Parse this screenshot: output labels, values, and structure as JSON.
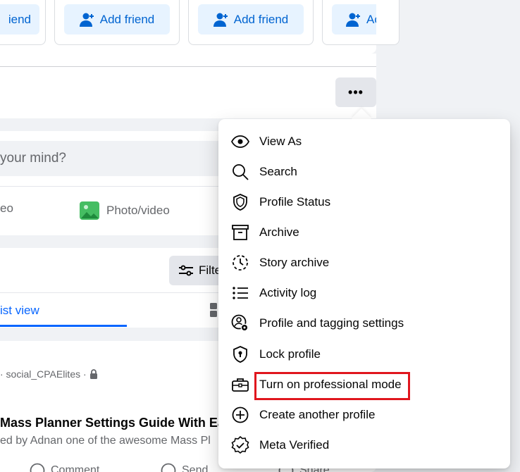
{
  "friends": {
    "add_label": "Add friend",
    "partial_first": "iend",
    "partial_last": "Ac"
  },
  "profile": {
    "more_label": "•••"
  },
  "composer": {
    "placeholder": "your mind?",
    "live_partial": "eo",
    "photo_label": "Photo/video"
  },
  "posts": {
    "filter_label": "Filte",
    "list_view_label": "ist view"
  },
  "post": {
    "meta": "· social_CPAElites ·",
    "title": "Mass Planner Settings Guide With Ea",
    "subtitle": "ed by Adnan one of the awesome Mass Pl",
    "comment": "Comment",
    "send": "Send",
    "share": "Share"
  },
  "menu": {
    "items": [
      {
        "label": "View As",
        "icon": "eye-icon"
      },
      {
        "label": "Search",
        "icon": "search-icon"
      },
      {
        "label": "Profile Status",
        "icon": "shield-icon"
      },
      {
        "label": "Archive",
        "icon": "archive-icon"
      },
      {
        "label": "Story archive",
        "icon": "story-archive-icon"
      },
      {
        "label": "Activity log",
        "icon": "list-icon"
      },
      {
        "label": "Profile and tagging settings",
        "icon": "user-gear-icon"
      },
      {
        "label": "Lock profile",
        "icon": "lock-shield-icon"
      },
      {
        "label": "Turn on professional mode",
        "icon": "briefcase-icon"
      },
      {
        "label": "Create another profile",
        "icon": "plus-circle-icon"
      },
      {
        "label": "Meta Verified",
        "icon": "verified-badge-icon"
      }
    ],
    "highlighted_index": 8,
    "highlight_color": "#e0161e"
  },
  "colors": {
    "accent": "#0866ff",
    "button_blue_bg": "#e7f3ff",
    "button_blue_text": "#0064d1"
  }
}
